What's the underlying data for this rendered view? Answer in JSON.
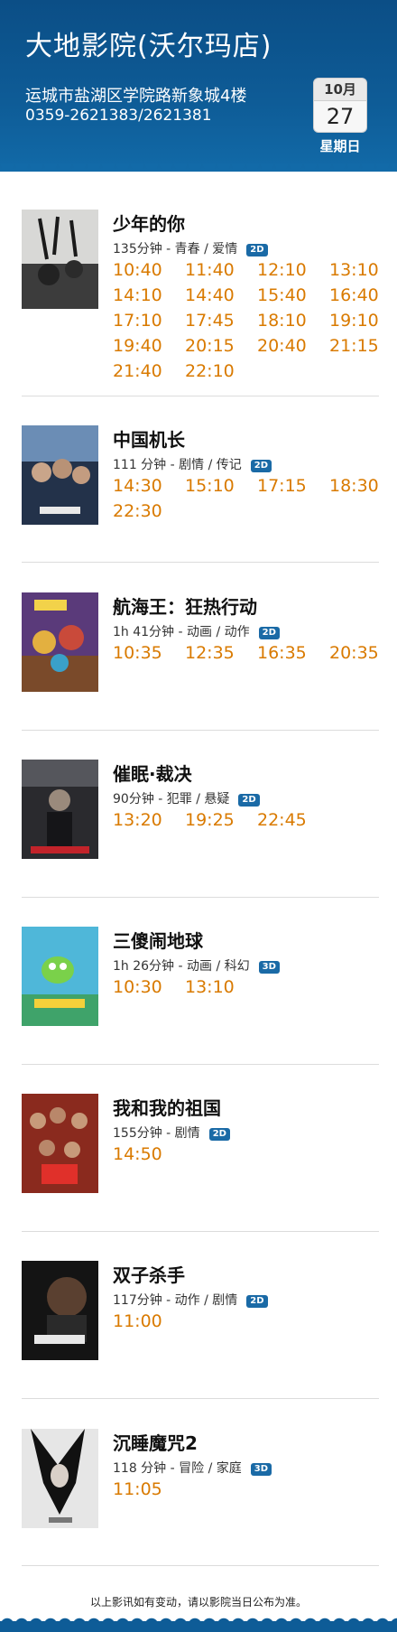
{
  "cinema": {
    "name": "大地影院(沃尔玛店)",
    "address": "运城市盐湖区学院路新象城4楼",
    "phone": "0359-2621383/2621381"
  },
  "date": {
    "month": "10月",
    "day": "27",
    "weekday": "星期日"
  },
  "colors": {
    "header": "#0e5c97",
    "time": "#d97a00",
    "badge": "#1a6aa6"
  },
  "movies": [
    {
      "title": "少年的你",
      "meta": "135分钟 - 青春 / 爱情",
      "format": "2D",
      "times": [
        "10:40",
        "11:40",
        "12:10",
        "13:10",
        "14:10",
        "14:40",
        "15:40",
        "16:40",
        "17:10",
        "17:45",
        "18:10",
        "19:10",
        "19:40",
        "20:15",
        "20:40",
        "21:15",
        "21:40",
        "22:10"
      ]
    },
    {
      "title": "中国机长",
      "meta": "111 分钟 - 剧情 / 传记",
      "format": "2D",
      "times": [
        "14:30",
        "15:10",
        "17:15",
        "18:30",
        "22:30"
      ]
    },
    {
      "title": "航海王：狂热行动",
      "meta": "1h 41分钟 - 动画 / 动作",
      "format": "2D",
      "times": [
        "10:35",
        "12:35",
        "16:35",
        "20:35"
      ]
    },
    {
      "title": "催眠·裁决",
      "meta": "90分钟 - 犯罪 / 悬疑",
      "format": "2D",
      "times": [
        "13:20",
        "19:25",
        "22:45"
      ]
    },
    {
      "title": "三傻闹地球",
      "meta": "1h 26分钟 - 动画 / 科幻",
      "format": "3D",
      "times": [
        "10:30",
        "13:10"
      ]
    },
    {
      "title": "我和我的祖国",
      "meta": "155分钟 - 剧情",
      "format": "2D",
      "times": [
        "14:50"
      ]
    },
    {
      "title": "双子杀手",
      "meta": "117分钟 - 动作 / 剧情",
      "format": "2D",
      "times": [
        "11:00"
      ]
    },
    {
      "title": "沉睡魔咒2",
      "meta": "118 分钟 - 冒险 / 家庭",
      "format": "3D",
      "times": [
        "11:05"
      ]
    }
  ],
  "footer": "以上影讯如有变动，请以影院当日公布为准。"
}
